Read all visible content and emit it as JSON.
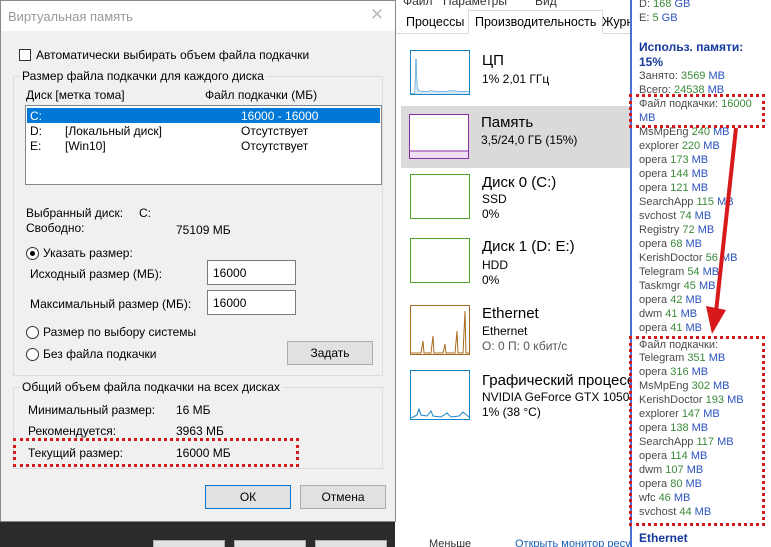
{
  "task_manager": {
    "menu": [
      "Файл",
      "Параметры",
      "Вид"
    ],
    "tabs": [
      "Процессы",
      "Производительность",
      "Журна"
    ],
    "active_tab": 1,
    "items": [
      {
        "name": "ЦП",
        "line1": "1% 2,01 ГГц",
        "line2": ""
      },
      {
        "name": "Память",
        "line1": "3,5/24,0 ГБ (15%)",
        "line2": ""
      },
      {
        "name": "Диск 0 (C:)",
        "line1": "SSD",
        "line2": "0%"
      },
      {
        "name": "Диск 1 (D: E:)",
        "line1": "HDD",
        "line2": "0%"
      },
      {
        "name": "Ethernet",
        "line1": "Ethernet",
        "line2": "О: 0 П: 0 кбит/с"
      },
      {
        "name": "Графический процессор 0",
        "line1": "NVIDIA GeForce GTX 1050 Ti",
        "line2": "1% (38 °C)"
      }
    ],
    "bottom_left": "Меньше",
    "bottom_link": "Открыть монитор ресурсов",
    "colors": {
      "cpu": "#1a84c8",
      "memory": "#8b2ea5",
      "disk": "#4fa02a",
      "ethernet": "#a86b1e",
      "gpu": "#1a84c8"
    }
  },
  "dialog": {
    "title": "Виртуальная память",
    "auto_checkbox_label": "Автоматически выбирать объем файла подкачки",
    "auto_checked": false,
    "group1_title": "Размер файла подкачки для каждого диска",
    "col_disk": "Диск [метка тома]",
    "col_size": "Файл подкачки (МБ)",
    "disks": [
      {
        "drive": "C:",
        "label": "",
        "size": "16000 - 16000",
        "selected": true
      },
      {
        "drive": "D:",
        "label": "[Локальный диск]",
        "size": "Отсутствует",
        "selected": false
      },
      {
        "drive": "E:",
        "label": "[Win10]",
        "size": "Отсутствует",
        "selected": false
      }
    ],
    "selected_disk_label": "Выбранный диск:",
    "selected_disk_value": "C:",
    "free_label": "Свободно:",
    "free_value": "75109 МБ",
    "radio_custom": "Указать размер:",
    "initial_label": "Исходный размер (МБ):",
    "initial_value": "16000",
    "max_label": "Максимальный размер (МБ):",
    "max_value": "16000",
    "radio_system": "Размер по выбору системы",
    "radio_none": "Без файла подкачки",
    "set_button": "Задать",
    "group2_title": "Общий объем файла подкачки на всех дисках",
    "min_label": "Минимальный размер:",
    "min_value": "16 МБ",
    "rec_label": "Рекомендуется:",
    "rec_value": "3963 МБ",
    "cur_label": "Текущий размер:",
    "cur_value": "16000 МБ",
    "ok_button": "ОК",
    "cancel_button": "Отмена"
  },
  "overlay": {
    "top_lines": [
      {
        "name": "D:",
        "value": "168",
        "unit": "GB"
      },
      {
        "name": "E:",
        "value": "5",
        "unit": "GB"
      }
    ],
    "mem_heading": "Использ. памяти:",
    "mem_percent": "15%",
    "busy": {
      "name": "Занято:",
      "value": "3569",
      "unit": "MB"
    },
    "total": {
      "name": "Всего:",
      "value": "24538",
      "unit": "MB"
    },
    "pagefile_label": "Файл подкачки:",
    "pagefile_value": "16000",
    "pagefile_unit": "MB",
    "mem_processes": [
      {
        "name": "MsMpEng",
        "value": "240",
        "unit": "MB"
      },
      {
        "name": "explorer",
        "value": "220",
        "unit": "MB"
      },
      {
        "name": "opera",
        "value": "173",
        "unit": "MB"
      },
      {
        "name": "opera",
        "value": "144",
        "unit": "MB"
      },
      {
        "name": "opera",
        "value": "121",
        "unit": "MB"
      },
      {
        "name": "SearchApp",
        "value": "115",
        "unit": "MB"
      },
      {
        "name": "svchost",
        "value": "74",
        "unit": "MB"
      },
      {
        "name": "Registry",
        "value": "72",
        "unit": "MB"
      },
      {
        "name": "opera",
        "value": "68",
        "unit": "MB"
      },
      {
        "name": "KerishDoctor",
        "value": "56",
        "unit": "MB"
      },
      {
        "name": "Telegram",
        "value": "54",
        "unit": "MB"
      },
      {
        "name": "Taskmgr",
        "value": "45",
        "unit": "MB"
      },
      {
        "name": "opera",
        "value": "42",
        "unit": "MB"
      },
      {
        "name": "dwm",
        "value": "41",
        "unit": "MB"
      },
      {
        "name": "opera",
        "value": "41",
        "unit": "MB"
      }
    ],
    "swap_heading": "Файл подкачки:",
    "swap_processes": [
      {
        "name": "Telegram",
        "value": "351",
        "unit": "MB"
      },
      {
        "name": "opera",
        "value": "316",
        "unit": "MB"
      },
      {
        "name": "MsMpEng",
        "value": "302",
        "unit": "MB"
      },
      {
        "name": "KerishDoctor",
        "value": "193",
        "unit": "MB"
      },
      {
        "name": "explorer",
        "value": "147",
        "unit": "MB"
      },
      {
        "name": "opera",
        "value": "138",
        "unit": "MB"
      },
      {
        "name": "SearchApp",
        "value": "117",
        "unit": "MB"
      },
      {
        "name": "opera",
        "value": "114",
        "unit": "MB"
      },
      {
        "name": "dwm",
        "value": "107",
        "unit": "MB"
      },
      {
        "name": "opera",
        "value": "80",
        "unit": "MB"
      },
      {
        "name": "wfc",
        "value": "46",
        "unit": "MB"
      },
      {
        "name": "svchost",
        "value": "44",
        "unit": "MB"
      }
    ],
    "footer_heading": "Ethernet"
  }
}
